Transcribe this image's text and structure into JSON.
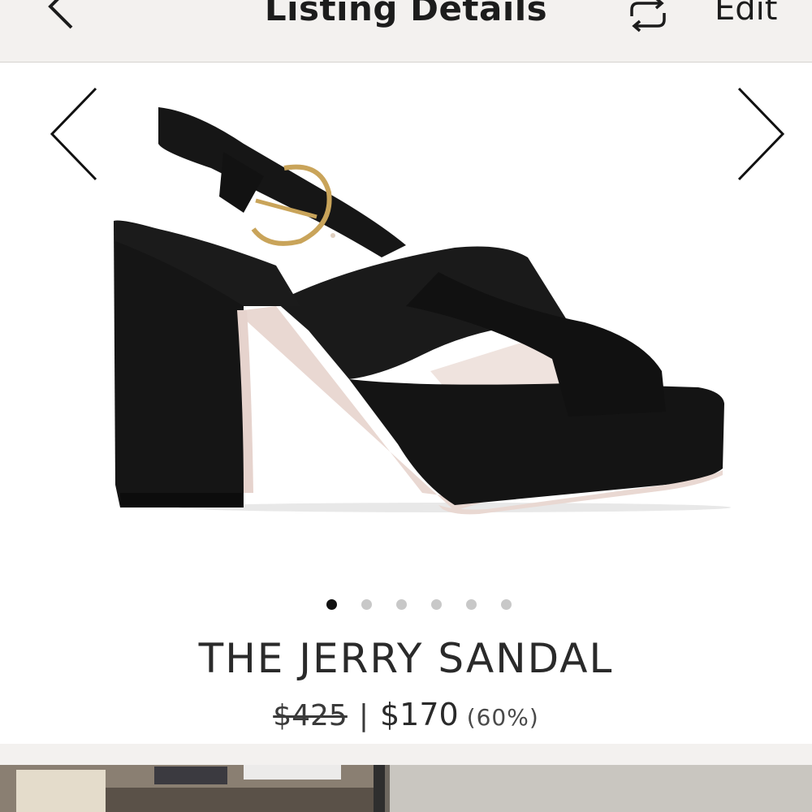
{
  "header": {
    "title": "Listing Details",
    "edit_label": "Edit"
  },
  "icons": {
    "back": "chevron-left-icon",
    "refresh": "refresh-icon",
    "prev": "chevron-left-icon",
    "next": "chevron-right-icon"
  },
  "carousel": {
    "dot_count": 6,
    "active_index": 0
  },
  "product": {
    "name": "THE JERRY SANDAL",
    "original_price": "$425",
    "separator": "|",
    "sale_price": "$170",
    "discount": "(60%)"
  },
  "colors": {
    "header_bg": "#f3f1ef",
    "text": "#222222",
    "dot_inactive": "#c8c8c8",
    "dot_active": "#111111"
  }
}
